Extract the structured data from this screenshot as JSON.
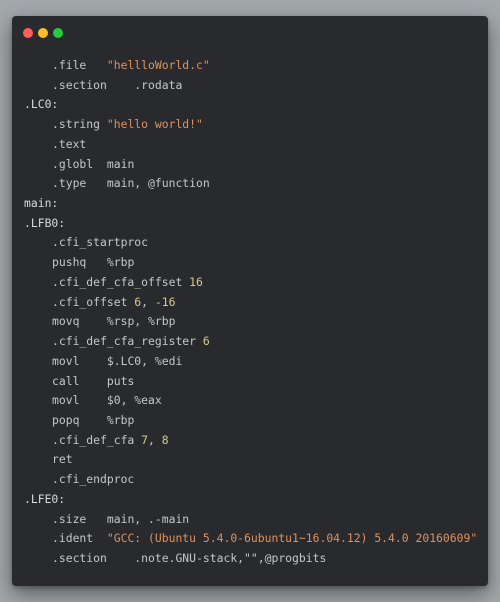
{
  "window": {
    "traffic_lights": {
      "close_color": "#ff5f56",
      "minimize_color": "#ffbd2e",
      "maximize_color": "#27c93f"
    }
  },
  "code": {
    "lines": [
      {
        "indent": true,
        "parts": [
          {
            "t": ".file",
            "c": "dir"
          },
          {
            "t": "   ",
            "c": "op"
          },
          {
            "t": "\"hellloWorld.c\"",
            "c": "str"
          }
        ]
      },
      {
        "indent": true,
        "parts": [
          {
            "t": ".section",
            "c": "dir"
          },
          {
            "t": "    .rodata",
            "c": "op"
          }
        ]
      },
      {
        "indent": false,
        "parts": [
          {
            "t": ".LC0:",
            "c": "lbl"
          }
        ]
      },
      {
        "indent": true,
        "parts": [
          {
            "t": ".string",
            "c": "dir"
          },
          {
            "t": " ",
            "c": "op"
          },
          {
            "t": "\"hello world!\"",
            "c": "str"
          }
        ]
      },
      {
        "indent": true,
        "parts": [
          {
            "t": ".text",
            "c": "dir"
          }
        ]
      },
      {
        "indent": true,
        "parts": [
          {
            "t": ".globl",
            "c": "dir"
          },
          {
            "t": "  main",
            "c": "op"
          }
        ]
      },
      {
        "indent": true,
        "parts": [
          {
            "t": ".type",
            "c": "dir"
          },
          {
            "t": "   main, @function",
            "c": "op"
          }
        ]
      },
      {
        "indent": false,
        "parts": [
          {
            "t": "main:",
            "c": "lbl"
          }
        ]
      },
      {
        "indent": false,
        "parts": [
          {
            "t": ".LFB0:",
            "c": "lbl"
          }
        ]
      },
      {
        "indent": true,
        "parts": [
          {
            "t": ".cfi_startproc",
            "c": "dir"
          }
        ]
      },
      {
        "indent": true,
        "parts": [
          {
            "t": "pushq",
            "c": "ins"
          },
          {
            "t": "   %rbp",
            "c": "op"
          }
        ]
      },
      {
        "indent": true,
        "parts": [
          {
            "t": ".cfi_def_cfa_offset",
            "c": "dir"
          },
          {
            "t": " ",
            "c": "op"
          },
          {
            "t": "16",
            "c": "num"
          }
        ]
      },
      {
        "indent": true,
        "parts": [
          {
            "t": ".cfi_offset",
            "c": "dir"
          },
          {
            "t": " ",
            "c": "op"
          },
          {
            "t": "6",
            "c": "num"
          },
          {
            "t": ", ",
            "c": "op"
          },
          {
            "t": "-16",
            "c": "num"
          }
        ]
      },
      {
        "indent": true,
        "parts": [
          {
            "t": "movq",
            "c": "ins"
          },
          {
            "t": "    %rsp, %rbp",
            "c": "op"
          }
        ]
      },
      {
        "indent": true,
        "parts": [
          {
            "t": ".cfi_def_cfa_register",
            "c": "dir"
          },
          {
            "t": " ",
            "c": "op"
          },
          {
            "t": "6",
            "c": "num"
          }
        ]
      },
      {
        "indent": true,
        "parts": [
          {
            "t": "movl",
            "c": "ins"
          },
          {
            "t": "    $.LC0, %edi",
            "c": "op"
          }
        ]
      },
      {
        "indent": true,
        "parts": [
          {
            "t": "call",
            "c": "ins"
          },
          {
            "t": "    puts",
            "c": "op"
          }
        ]
      },
      {
        "indent": true,
        "parts": [
          {
            "t": "movl",
            "c": "ins"
          },
          {
            "t": "    $0, %eax",
            "c": "op"
          }
        ]
      },
      {
        "indent": true,
        "parts": [
          {
            "t": "popq",
            "c": "ins"
          },
          {
            "t": "    %rbp",
            "c": "op"
          }
        ]
      },
      {
        "indent": true,
        "parts": [
          {
            "t": ".cfi_def_cfa",
            "c": "dir"
          },
          {
            "t": " ",
            "c": "op"
          },
          {
            "t": "7",
            "c": "num"
          },
          {
            "t": ", ",
            "c": "op"
          },
          {
            "t": "8",
            "c": "num"
          }
        ]
      },
      {
        "indent": true,
        "parts": [
          {
            "t": "ret",
            "c": "ins"
          }
        ]
      },
      {
        "indent": true,
        "parts": [
          {
            "t": ".cfi_endproc",
            "c": "dir"
          }
        ]
      },
      {
        "indent": false,
        "parts": [
          {
            "t": ".LFE0:",
            "c": "lbl"
          }
        ]
      },
      {
        "indent": true,
        "parts": [
          {
            "t": ".size",
            "c": "dir"
          },
          {
            "t": "   main, .-main",
            "c": "op"
          }
        ]
      },
      {
        "indent": true,
        "parts": [
          {
            "t": ".ident",
            "c": "dir"
          },
          {
            "t": "  ",
            "c": "op"
          },
          {
            "t": "\"GCC: (Ubuntu 5.4.0-6ubuntu1~16.04.12) 5.4.0 20160609\"",
            "c": "str"
          }
        ]
      },
      {
        "indent": true,
        "parts": [
          {
            "t": ".section",
            "c": "dir"
          },
          {
            "t": "    .note.GNU-stack,\"\",@progbits",
            "c": "op"
          }
        ]
      }
    ]
  }
}
